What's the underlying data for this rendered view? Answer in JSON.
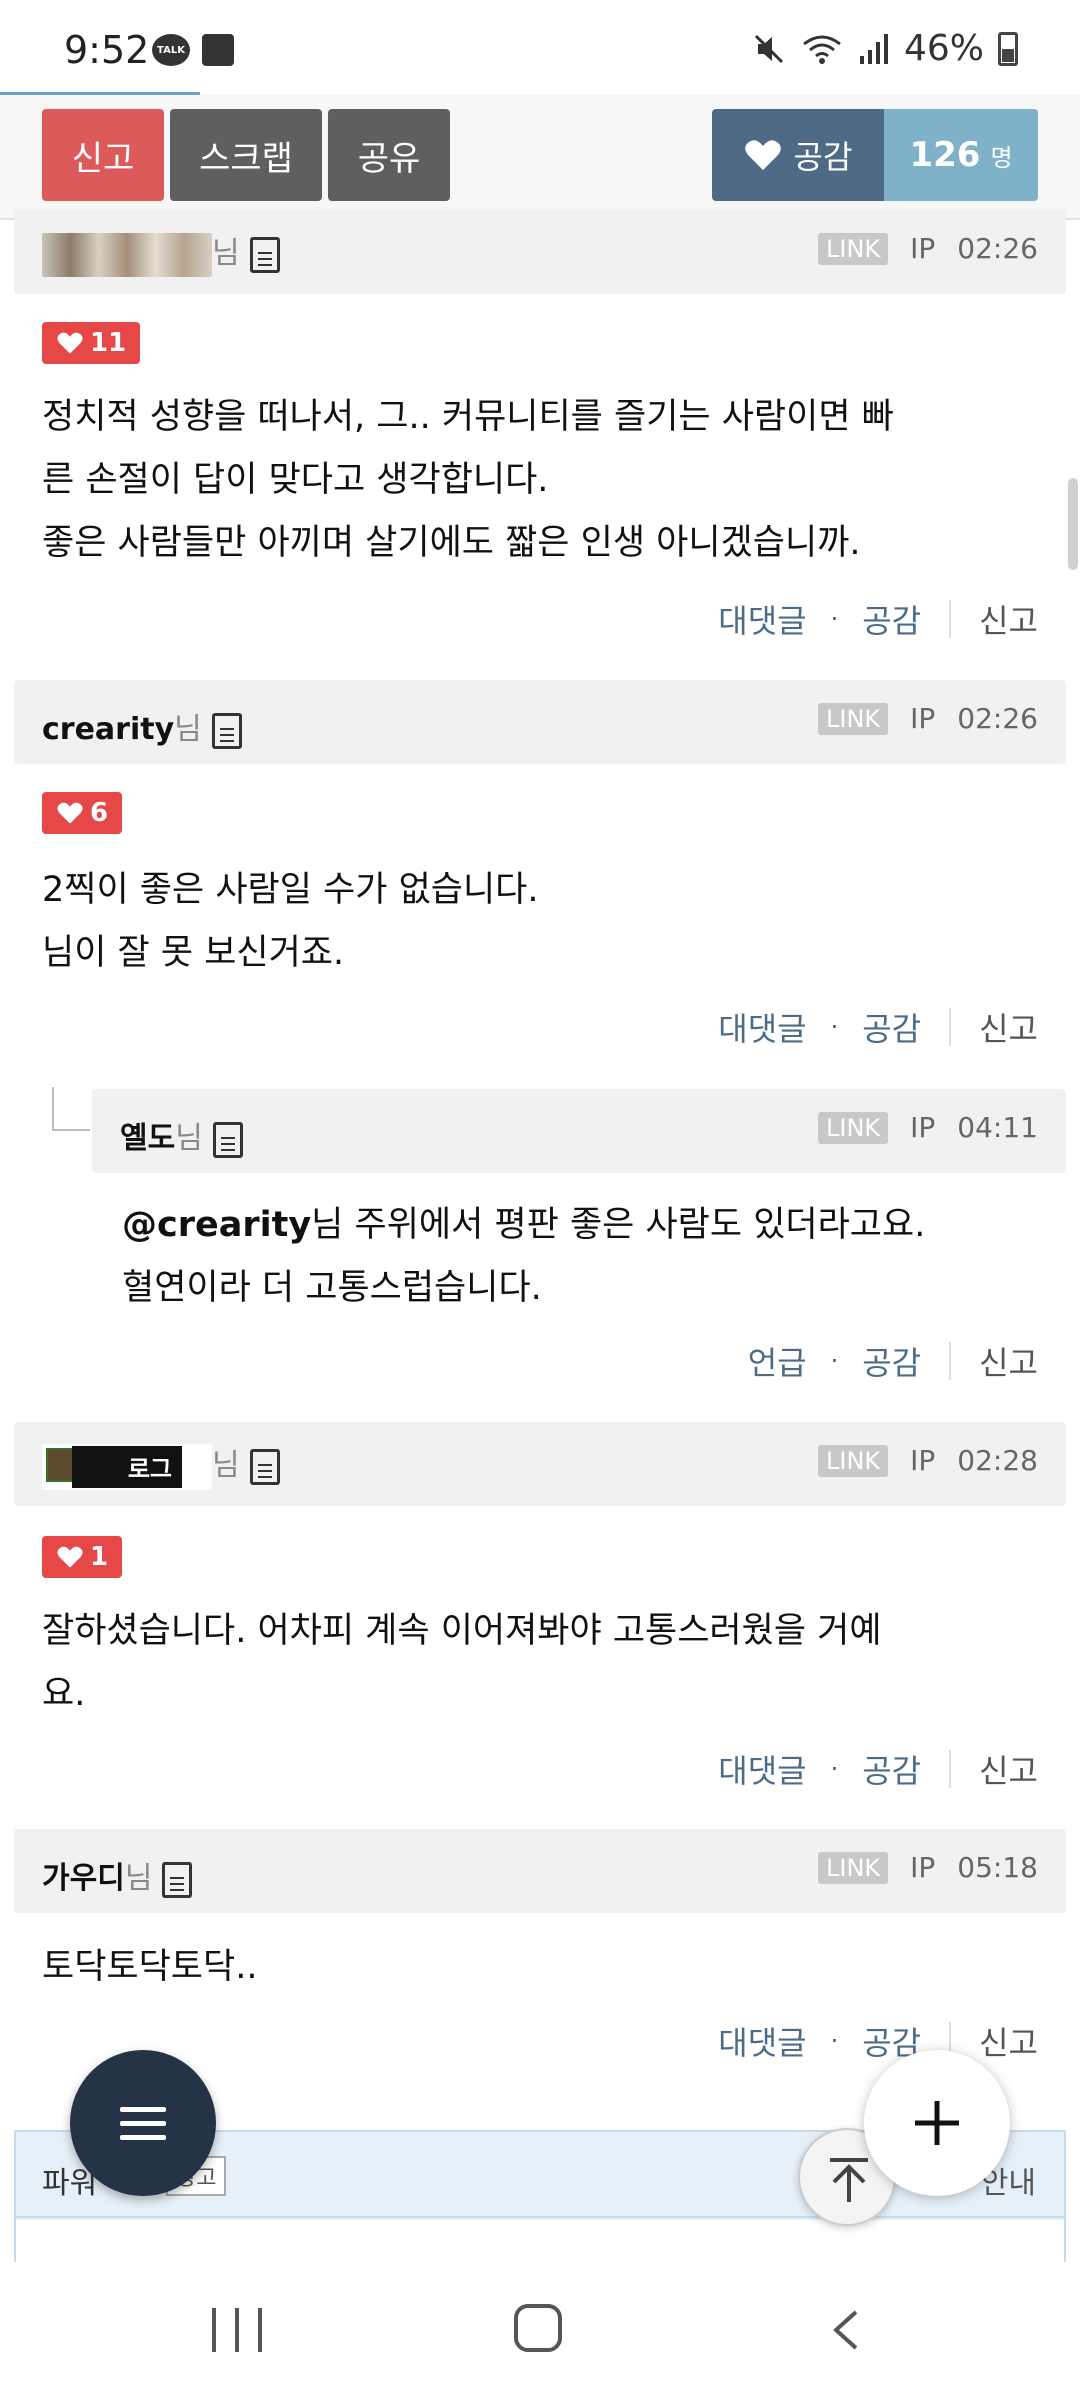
{
  "status_bar": {
    "time": "9:52",
    "talk_badge": "TALK",
    "battery": "46%",
    "icons": [
      "kakaotalk-icon",
      "gallery-icon",
      "mute-icon",
      "wifi-icon",
      "signal-icon",
      "battery-icon"
    ]
  },
  "toolbar": {
    "report_label": "신고",
    "scrap_label": "스크랩",
    "share_label": "공유",
    "like_label": "공감",
    "like_count": "126",
    "like_unit": "명"
  },
  "common": {
    "nim": "님",
    "link_badge": "LINK",
    "ip": "IP",
    "reply_action": "대댓글",
    "mention_action": "언급",
    "like_action": "공감",
    "report_action": "신고",
    "dot": "·"
  },
  "comments": [
    {
      "nickname": "",
      "avatar": "image",
      "time": "02:26",
      "likes": "11",
      "lines": [
        "정치적 성향을 떠나서, 그.. 커뮤니티를 즐기는 사람이면 빠",
        "른 손절이 답이 맞다고 생각합니다.",
        "좋은 사람들만 아끼며 살기에도 짧은 인생 아니겠습니까."
      ]
    },
    {
      "nickname": "crearity",
      "time": "02:26",
      "likes": "6",
      "lines": [
        "2찍이 좋은 사람일 수가 없습니다.",
        "님이 잘 못 보신거죠."
      ]
    },
    {
      "nickname": "옐도",
      "time": "04:11",
      "is_reply": true,
      "mention": "@crearity",
      "lines": [
        "님 주위에서 평판 좋은 사람도 있더라고요.",
        "혈연이라 더 고통스럽습니다."
      ]
    },
    {
      "nickname": "",
      "avatar_text": "로그",
      "time": "02:28",
      "likes": "1",
      "lines": [
        "잘하셨습니다. 어차피 계속 이어져봐야 고통스러웠을 거예",
        "요."
      ]
    },
    {
      "nickname": "가우디",
      "time": "05:18",
      "lines": [
        "토닥토닥토닥.."
      ]
    }
  ],
  "power_link": {
    "title": "파워",
    "ad_badge": "광고",
    "guide": "안내"
  },
  "colors": {
    "report_red": "#dd5a5a",
    "like_red": "#e64848",
    "action_blue": "#4b6b86",
    "fab_dark": "#243446"
  }
}
